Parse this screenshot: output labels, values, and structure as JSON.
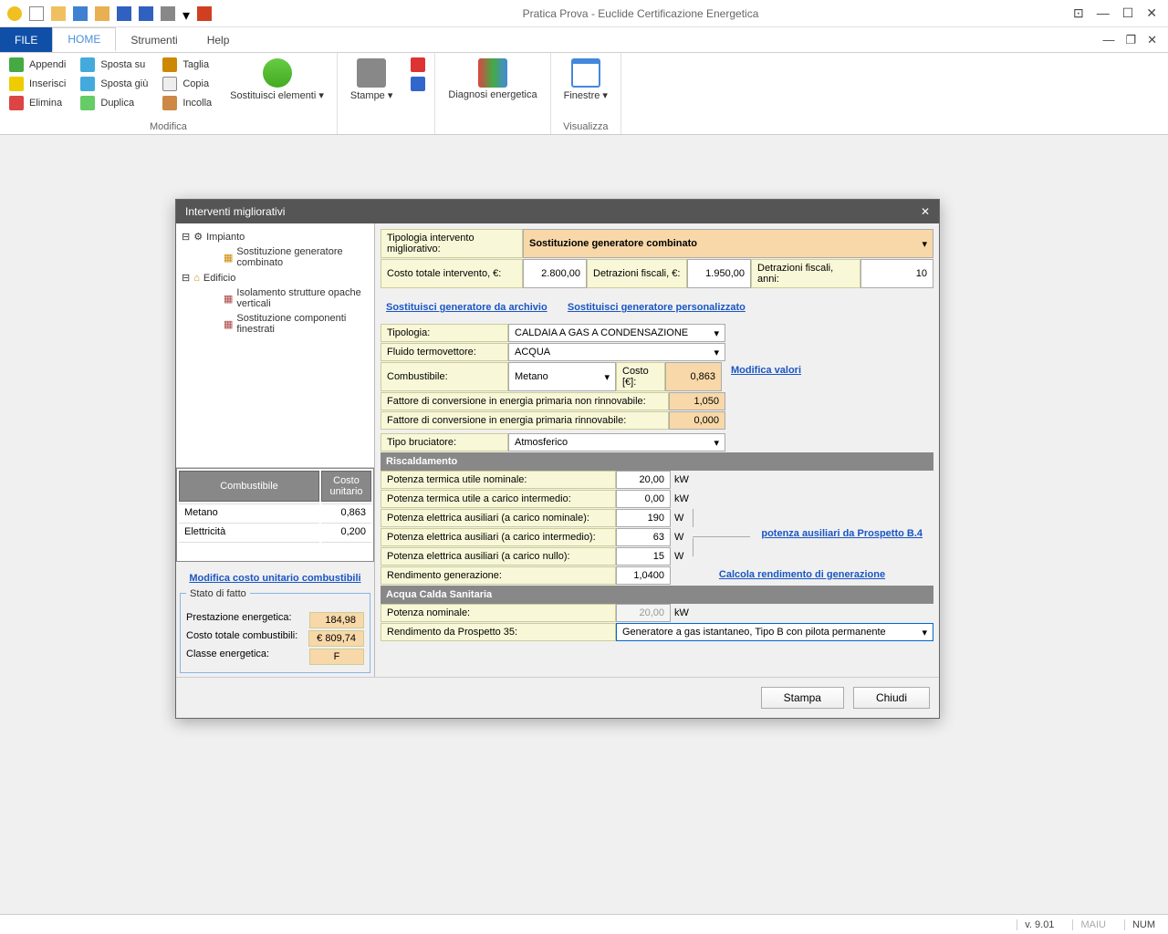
{
  "app": {
    "title": "Pratica Prova - Euclide Certificazione Energetica"
  },
  "tabs": {
    "file": "FILE",
    "home": "HOME",
    "strumenti": "Strumenti",
    "help": "Help"
  },
  "ribbon": {
    "appendi": "Appendi",
    "inserisci": "Inserisci",
    "elimina": "Elimina",
    "sposta_su": "Sposta su",
    "sposta_giu": "Sposta giù",
    "duplica": "Duplica",
    "taglia": "Taglia",
    "copia": "Copia",
    "incolla": "Incolla",
    "sostituisci": "Sostituisci elementi ▾",
    "modifica_label": "Modifica",
    "stampe": "Stampe ▾",
    "diagnosi": "Diagnosi energetica",
    "finestre": "Finestre ▾",
    "visualizza_label": "Visualizza"
  },
  "dialog": {
    "title": "Interventi migliorativi",
    "tree": {
      "impianto": "Impianto",
      "sost_gen": "Sostituzione generatore combinato",
      "edificio": "Edificio",
      "isolamento": "Isolamento strutture opache verticali",
      "sost_comp": "Sostituzione componenti finestrati"
    },
    "fuel_table": {
      "h1": "Combustibile",
      "h2": "Costo unitario",
      "r1c1": "Metano",
      "r1c2": "0,863",
      "r2c1": "Elettricità",
      "r2c2": "0,200"
    },
    "mod_cost_link": "Modifica costo unitario combustibili",
    "stato": {
      "title": "Stato di fatto",
      "prest": "Prestazione energetica:",
      "prest_v": "184,98",
      "costo": "Costo totale combustibili:",
      "costo_v": "€ 809,74",
      "classe": "Classe energetica:",
      "classe_v": "F"
    },
    "form": {
      "tipologia_int": "Tipologia intervento migliorativo:",
      "tipologia_int_v": "Sostituzione generatore combinato",
      "costo_tot": "Costo totale intervento, €:",
      "costo_tot_v": "2.800,00",
      "detraz": "Detrazioni fiscali, €:",
      "detraz_v": "1.950,00",
      "detraz_anni": "Detrazioni fiscali, anni:",
      "detraz_anni_v": "10",
      "link1": "Sostituisci generatore da archivio",
      "link2": "Sostituisci generatore personalizzato",
      "tipologia": "Tipologia:",
      "tipologia_v": "CALDAIA A GAS A CONDENSAZIONE",
      "fluido": "Fluido termovettore:",
      "fluido_v": "ACQUA",
      "combust": "Combustibile:",
      "combust_v": "Metano",
      "costo_e": "Costo [€]:",
      "costo_e_v": "0,863",
      "mod_valori": "Modifica valori",
      "fatt_nr": "Fattore di conversione in energia primaria non rinnovabile:",
      "fatt_nr_v": "1,050",
      "fatt_r": "Fattore di conversione in energia primaria rinnovabile:",
      "fatt_r_v": "0,000",
      "tipo_bruc": "Tipo bruciatore:",
      "tipo_bruc_v": "Atmosferico",
      "risc_hdr": "Riscaldamento",
      "pot_nom": "Potenza termica utile nominale:",
      "pot_nom_v": "20,00",
      "kw": "kW",
      "pot_int": "Potenza termica utile a carico intermedio:",
      "pot_int_v": "0,00",
      "pot_el_nom": "Potenza elettrica ausiliari (a carico nominale):",
      "pot_el_nom_v": "190",
      "w": "W",
      "pot_el_int": "Potenza elettrica ausiliari (a carico intermedio):",
      "pot_el_int_v": "63",
      "pot_el_null": "Potenza elettrica ausiliari (a carico nullo):",
      "pot_el_null_v": "15",
      "link_aux": "potenza ausiliari da Prospetto B.4",
      "rend_gen": "Rendimento generazione:",
      "rend_gen_v": "1,0400",
      "link_calc": "Calcola rendimento di generazione",
      "acs_hdr": "Acqua Calda Sanitaria",
      "pot_acs": "Potenza nominale:",
      "pot_acs_v": "20,00",
      "rend35": "Rendimento da Prospetto 35:",
      "rend35_v": "Generatore a gas istantaneo, Tipo B con pilota permanente"
    },
    "btn_stampa": "Stampa",
    "btn_chiudi": "Chiudi"
  },
  "status": {
    "version": "v. 9.01",
    "maiu": "MAIU",
    "num": "NUM"
  }
}
